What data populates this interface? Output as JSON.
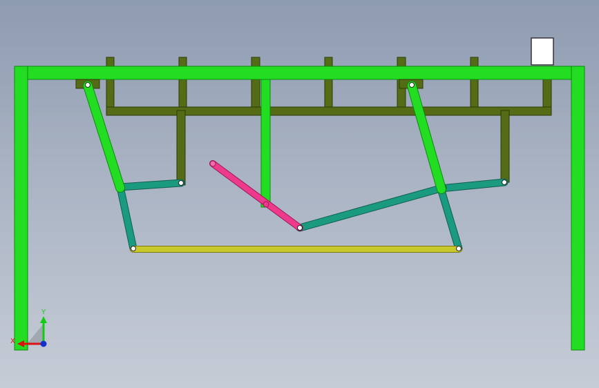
{
  "scene": {
    "background_top": "#8e9bb0",
    "background_bottom": "#c6ccd6",
    "frame_color": "#22dd22",
    "frame_edge": "#0a8a0a",
    "rack_color": "#556b16",
    "rack_edge": "#2d3a08",
    "link_color": "#1a9a7e",
    "coupler_color": "#c8c82a",
    "crank_color": "#ee3a8c",
    "pin_color": "#ffffff"
  },
  "triad": {
    "x_label": "X",
    "y_label": "Y",
    "x_color": "#dd1111",
    "y_color": "#11cc11",
    "z_color": "#1133cc"
  }
}
